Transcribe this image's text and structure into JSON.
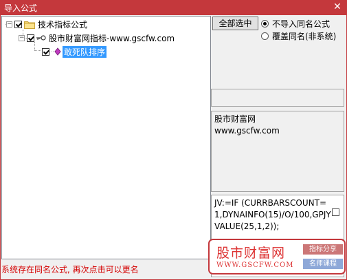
{
  "window": {
    "title": "导入公式",
    "close_glyph": "✕"
  },
  "tree": {
    "root": {
      "label": "技术指标公式",
      "checked": true,
      "icon": "folder-icon"
    },
    "child": {
      "label": "股市财富网指标-www.gscfw.com",
      "checked": true,
      "icon": "key-icon"
    },
    "leaf": {
      "label": "敢死队排序",
      "checked": true,
      "selected": true,
      "icon": "formula-icon"
    }
  },
  "options": {
    "select_all_label": "全部选中",
    "radio_skip_label": "不导入同名公式",
    "radio_overwrite_label": "覆盖同名(非系统)",
    "selected_radio": "radio_skip_label"
  },
  "info": {
    "line1": "股市财富网",
    "line2": "www.gscfw.com"
  },
  "code": {
    "text": "JV:=IF (CURRBARSCOUNT=1,DYNAINFO(15)/O/100,GPJYVALUE(25,1,2));"
  },
  "status_text": "系统存在同名公式, 再次点击可以更名",
  "brand": {
    "name": "股市财富网",
    "url": "WWW.GSCFW.COM",
    "tag1": "指标分享",
    "tag2": "名师课程"
  },
  "colors": {
    "titlebar": "#c4383c",
    "selection": "#3399ff",
    "status": "#d40000"
  }
}
